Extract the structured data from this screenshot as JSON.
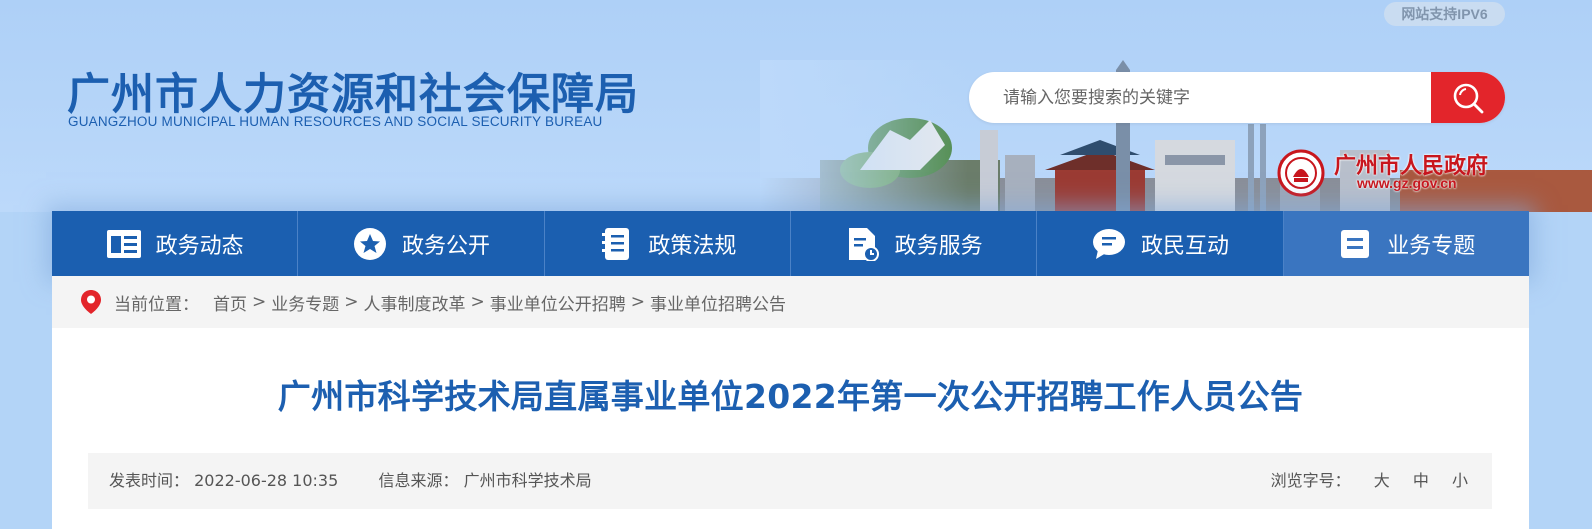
{
  "header": {
    "ipv6_badge": "网站支持IPV6",
    "logo_cn": "广州市人力资源和社会保障局",
    "logo_en": "GUANGZHOU MUNICIPAL HUMAN RESOURCES AND SOCIAL SECURITY BUREAU",
    "search": {
      "placeholder": "请输入您要搜索的关键字"
    },
    "gov_logo": {
      "name": "广州市人民政府",
      "url": "www.gz.gov.cn"
    }
  },
  "nav": {
    "items": [
      {
        "label": "政务动态",
        "icon": "news-icon"
      },
      {
        "label": "政务公开",
        "icon": "star-icon"
      },
      {
        "label": "政策法规",
        "icon": "document-icon"
      },
      {
        "label": "政务服务",
        "icon": "file-service-icon"
      },
      {
        "label": "政民互动",
        "icon": "chat-icon"
      },
      {
        "label": "业务专题",
        "icon": "list-icon"
      }
    ]
  },
  "breadcrumb": {
    "label": "当前位置：",
    "items": [
      "首页",
      "业务专题",
      "人事制度改革",
      "事业单位公开招聘",
      "事业单位招聘公告"
    ],
    "separator": ">"
  },
  "article": {
    "title": "广州市科学技术局直属事业单位2022年第一次公开招聘工作人员公告",
    "publish_label": "发表时间：",
    "publish_time": "2022-06-28 10:35",
    "source_label": "信息来源：",
    "source": "广州市科学技术局",
    "font_size_label": "浏览字号：",
    "font_sizes": [
      "大",
      "中",
      "小"
    ]
  },
  "colors": {
    "brand_blue": "#1b5fb0",
    "search_red": "#e3252b",
    "gov_red": "#c8161d",
    "page_bg": "#b3d4f7"
  }
}
